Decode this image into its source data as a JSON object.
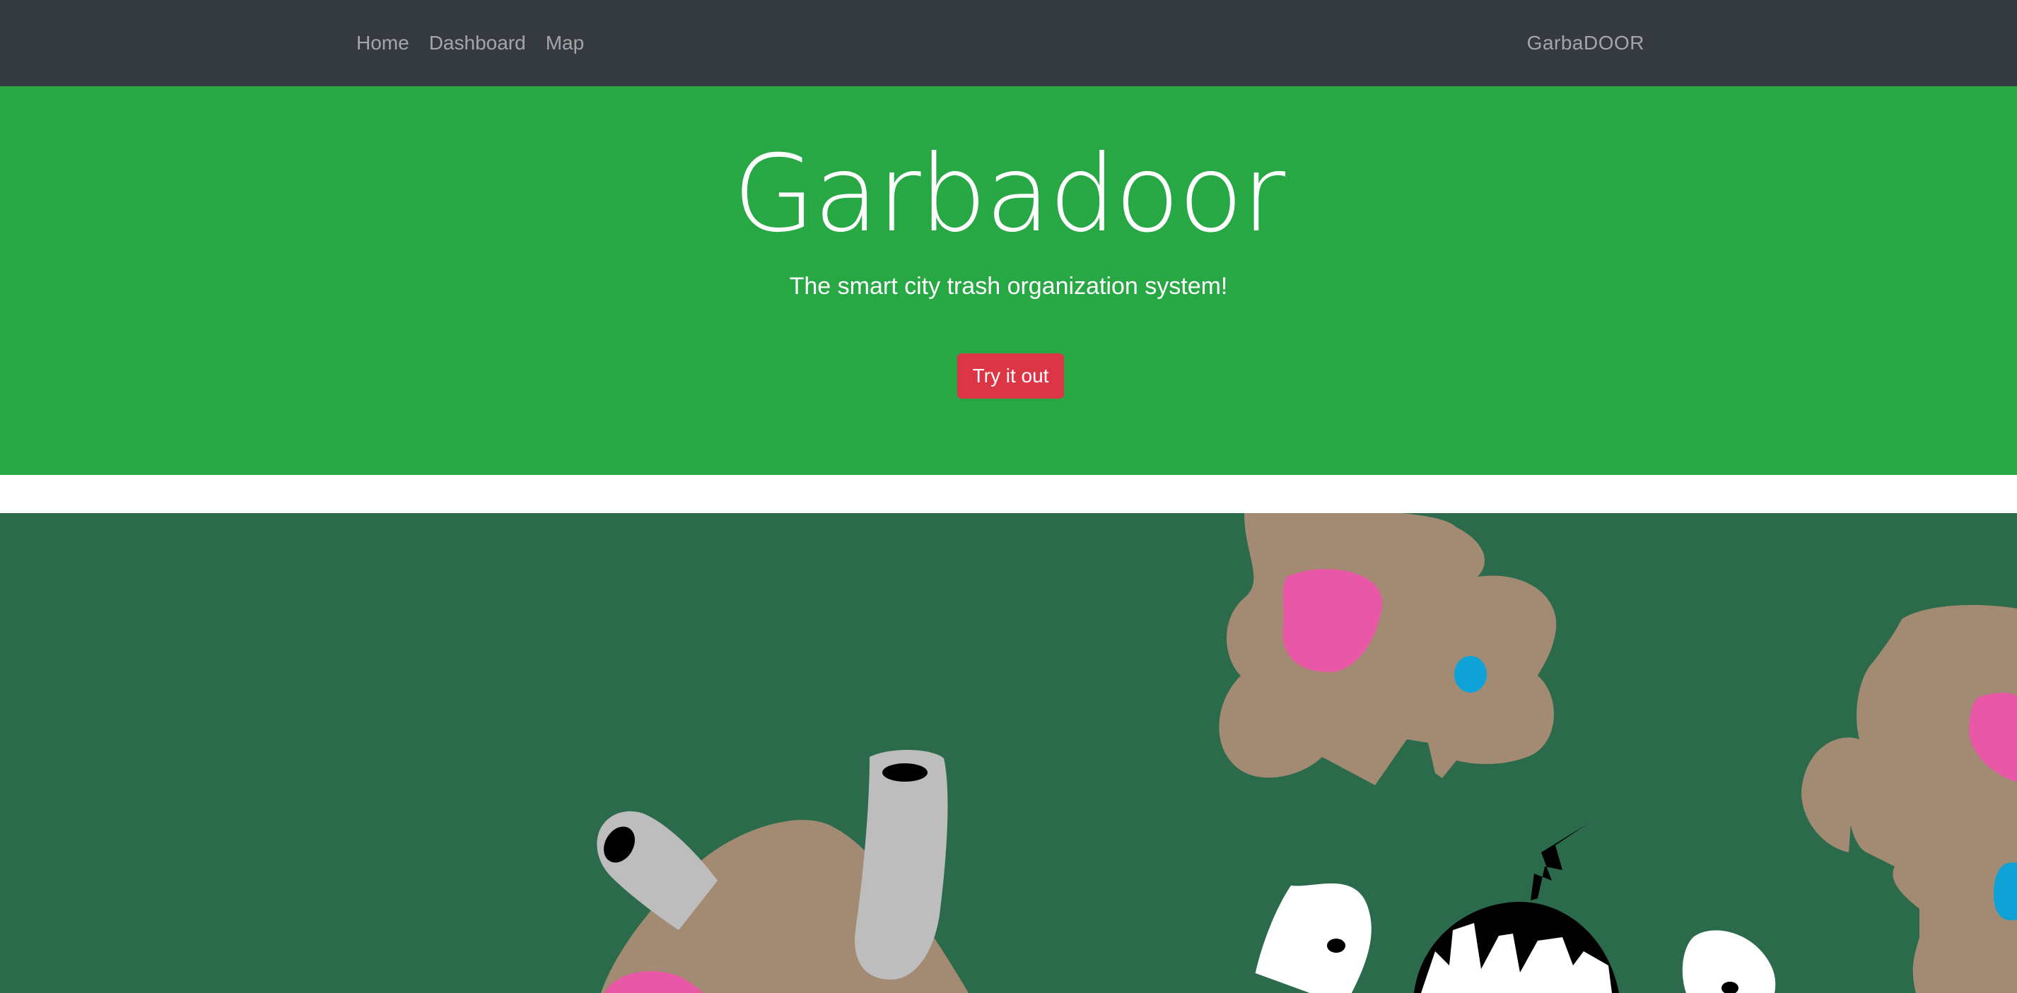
{
  "nav": {
    "links": [
      "Home",
      "Dashboard",
      "Map"
    ],
    "brand": "GarbaDOOR"
  },
  "hero": {
    "title": "Garbadoor",
    "tagline": "The smart city trash organization system!",
    "cta_label": "Try it out"
  },
  "colors": {
    "navbar": "#343a40",
    "hero_background": "#28a745",
    "cta": "#dc3545",
    "scene_background": "#2b6b4c",
    "monster_body": "#a38a73",
    "monster_cheek": "#e957a7",
    "monster_eye": "#0ea2d7",
    "pipe": "#bdbdbd"
  },
  "illustration": {
    "figures": [
      "trash-blob-monster",
      "trash-blob-monster",
      "pipe-creature",
      "grinning-shadow-monster"
    ]
  }
}
